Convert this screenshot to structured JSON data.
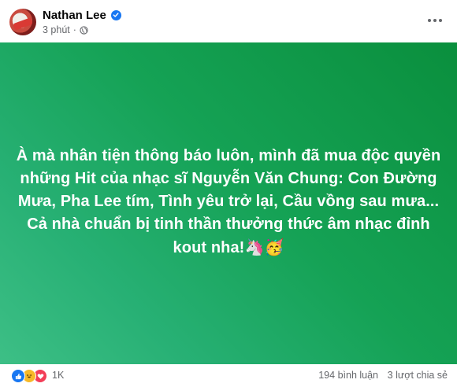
{
  "post": {
    "author": "Nathan Lee",
    "time": "3 phút",
    "separator": "·",
    "status_lines": [
      "À mà nhân tiện thông báo luôn, mình đã mua độc quyền",
      "những Hit của nhạc sĩ Nguyễn Văn Chung: Con Đường",
      "Mưa, Pha Lee tím, Tình yêu trở lại, Cầu vồng sau mưa...",
      "Cả nhà chuẩn bị tinh thần thưởng thức âm nhạc đỉnh",
      "kout nha!"
    ],
    "status_emojis": "🦄🥳",
    "background_colors": [
      "#3dbf86",
      "#15a255",
      "#0a8f3d"
    ]
  },
  "footer": {
    "reaction_count": "1K",
    "comments": "194 bình luận",
    "shares": "3 lượt chia sẻ",
    "reaction_icons": [
      "like-icon",
      "haha-icon",
      "love-icon"
    ]
  },
  "colors": {
    "accent": "#1877f2",
    "secondary_text": "#65676b"
  }
}
